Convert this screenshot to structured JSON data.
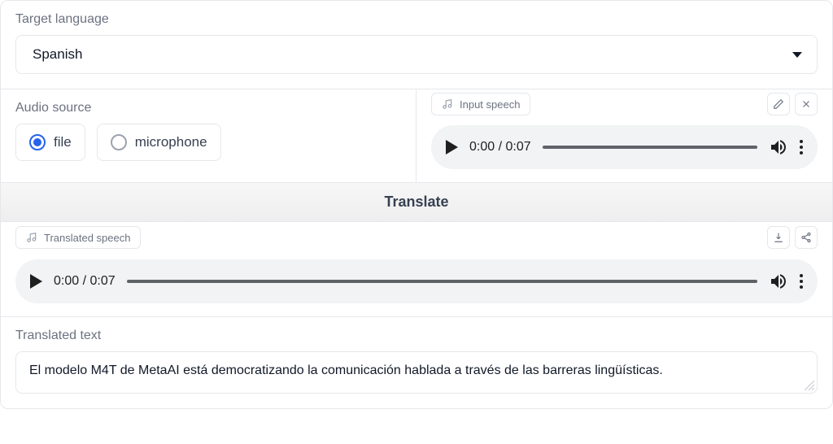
{
  "target_language": {
    "label": "Target language",
    "selected": "Spanish"
  },
  "audio_source": {
    "label": "Audio source",
    "options": {
      "file": "file",
      "microphone": "microphone"
    },
    "selected": "file"
  },
  "input_speech": {
    "label": "Input speech",
    "time_current": "0:00",
    "time_total": "0:07"
  },
  "translate_button": "Translate",
  "translated_speech": {
    "label": "Translated speech",
    "time_current": "0:00",
    "time_total": "0:07"
  },
  "translated_text": {
    "label": "Translated text",
    "value": "El modelo M4T de MetaAI está democratizando la comunicación hablada a través de las barreras lingüísticas."
  }
}
